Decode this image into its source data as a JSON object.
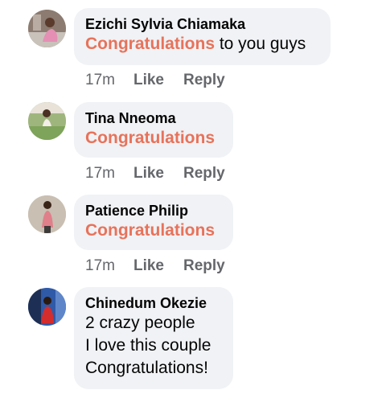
{
  "comments": [
    {
      "author": "Ezichi Sylvia Chiamaka",
      "highlight": "Congratulations",
      "text_after": " to you guys",
      "time": "17m",
      "like": "Like",
      "reply": "Reply"
    },
    {
      "author": "Tina Nneoma",
      "highlight": "Congratulations",
      "time": "17m",
      "like": "Like",
      "reply": "Reply"
    },
    {
      "author": "Patience Philip",
      "highlight": "Congratulations",
      "time": "17m",
      "like": "Like",
      "reply": "Reply"
    },
    {
      "author": "Chinedum Okezie",
      "lines": [
        "2 crazy people",
        "I love this couple",
        "Congratulations!"
      ]
    }
  ],
  "colors": {
    "mention": "#e8725a",
    "bubble": "#f0f2f5",
    "meta": "#65676b"
  }
}
